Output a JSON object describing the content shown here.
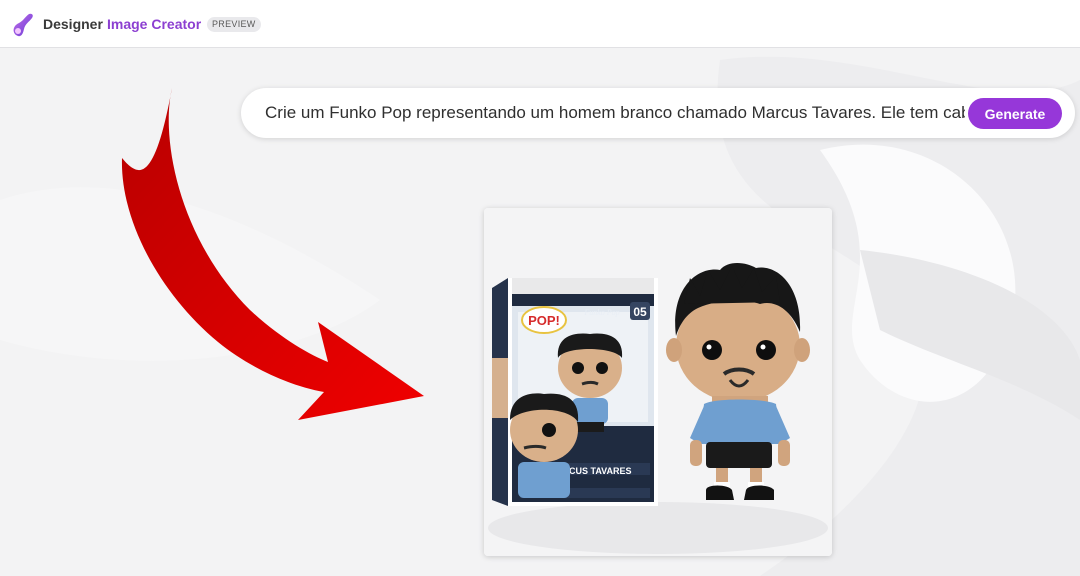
{
  "header": {
    "app_name": "Designer",
    "product_name": "Image Creator",
    "badge": "PREVIEW"
  },
  "prompt": {
    "value": "Crie um Funko Pop representando um homem branco chamado Marcus Tavares. Ele tem cabelo",
    "generate_label": "Generate"
  },
  "result": {
    "box_brand": "Funko Pop",
    "box_number": "05",
    "box_name": "MARCUS TAVARES",
    "pop_logo": "POP!"
  },
  "colors": {
    "accent": "#9637d9",
    "brand_text": "#8c3fd1",
    "arrow": "#d40000",
    "box_dark": "#1e2a3e",
    "shirt": "#6f9fd0"
  }
}
